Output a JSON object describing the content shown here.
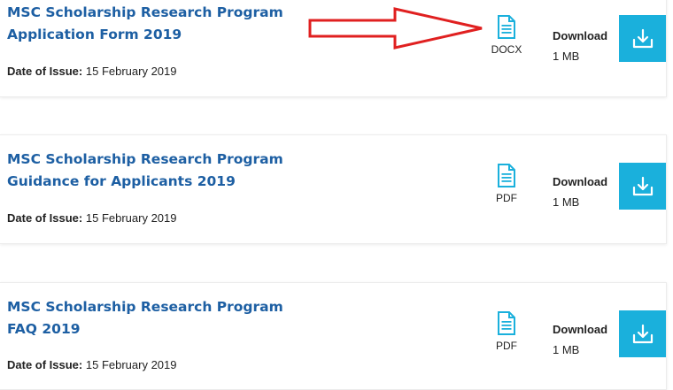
{
  "documents": [
    {
      "title": "MSC Scholarship Research Program Application Form 2019",
      "issue_label": "Date of Issue:",
      "issue_date": "15 February 2019",
      "file_type": "DOCX",
      "file_icon": "document-icon",
      "download_label": "Download",
      "size": "1 MB",
      "download_icon": "download-icon"
    },
    {
      "title": "MSC Scholarship Research Program Guidance for Applicants 2019",
      "issue_label": "Date of Issue:",
      "issue_date": "15 February 2019",
      "file_type": "PDF",
      "file_icon": "document-icon",
      "download_label": "Download",
      "size": "1 MB",
      "download_icon": "download-icon"
    },
    {
      "title": "MSC Scholarship Research Program FAQ 2019",
      "issue_label": "Date of Issue:",
      "issue_date": "15 February 2019",
      "file_type": "PDF",
      "file_icon": "document-icon",
      "download_label": "Download",
      "size": "1 MB",
      "download_icon": "download-icon"
    }
  ],
  "annotation": {
    "icon": "red-arrow-icon",
    "color": "#e02020"
  },
  "colors": {
    "title": "#1d5fa3",
    "accent": "#1ab0dc"
  }
}
